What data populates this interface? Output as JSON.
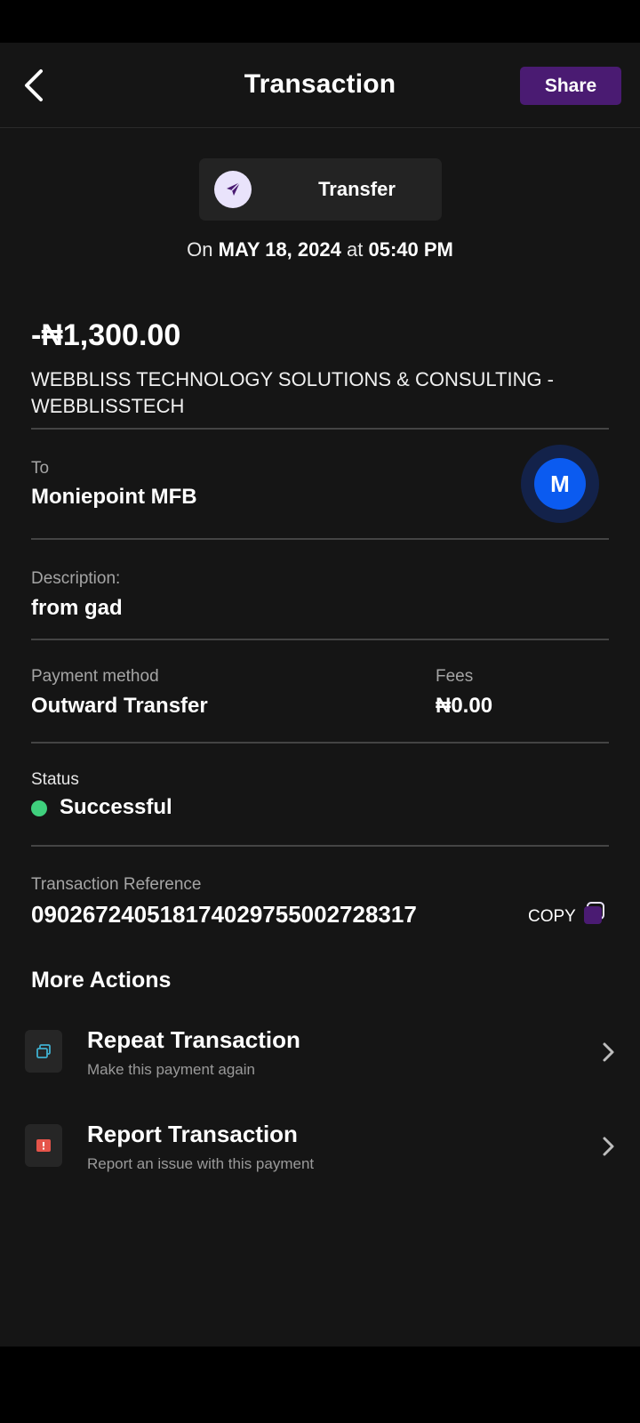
{
  "header": {
    "title": "Transaction",
    "share_label": "Share"
  },
  "transaction": {
    "type_label": "Transfer",
    "date_prefix": "On",
    "date": "MAY 18, 2024",
    "date_at": "at",
    "time": "05:40 PM",
    "amount": "-₦1,300.00",
    "recipient_name": "WEBBLISS TECHNOLOGY SOLUTIONS & CONSULTING - WEBBLISSTECH"
  },
  "details": {
    "to_label": "To",
    "to_value": "Moniepoint MFB",
    "bank_logo_letter": "M",
    "description_label": "Description:",
    "description_value": "from gad",
    "payment_method_label": "Payment method",
    "payment_method_value": "Outward Transfer",
    "fees_label": "Fees",
    "fees_value": "₦0.00",
    "status_label": "Status",
    "status_value": "Successful",
    "reference_label": "Transaction Reference",
    "reference_value": "090267240518174029755002728317",
    "copy_label": "COPY"
  },
  "more_actions": {
    "title": "More Actions",
    "items": [
      {
        "title": "Repeat Transaction",
        "subtitle": "Make this payment again",
        "icon": "repeat-icon"
      },
      {
        "title": "Report Transaction",
        "subtitle": "Report an issue with this payment",
        "icon": "report-icon"
      }
    ]
  },
  "colors": {
    "background": "#151515",
    "accent": "#4a1b72",
    "success": "#3fd07d",
    "bank_blue": "#0b5bf0"
  }
}
